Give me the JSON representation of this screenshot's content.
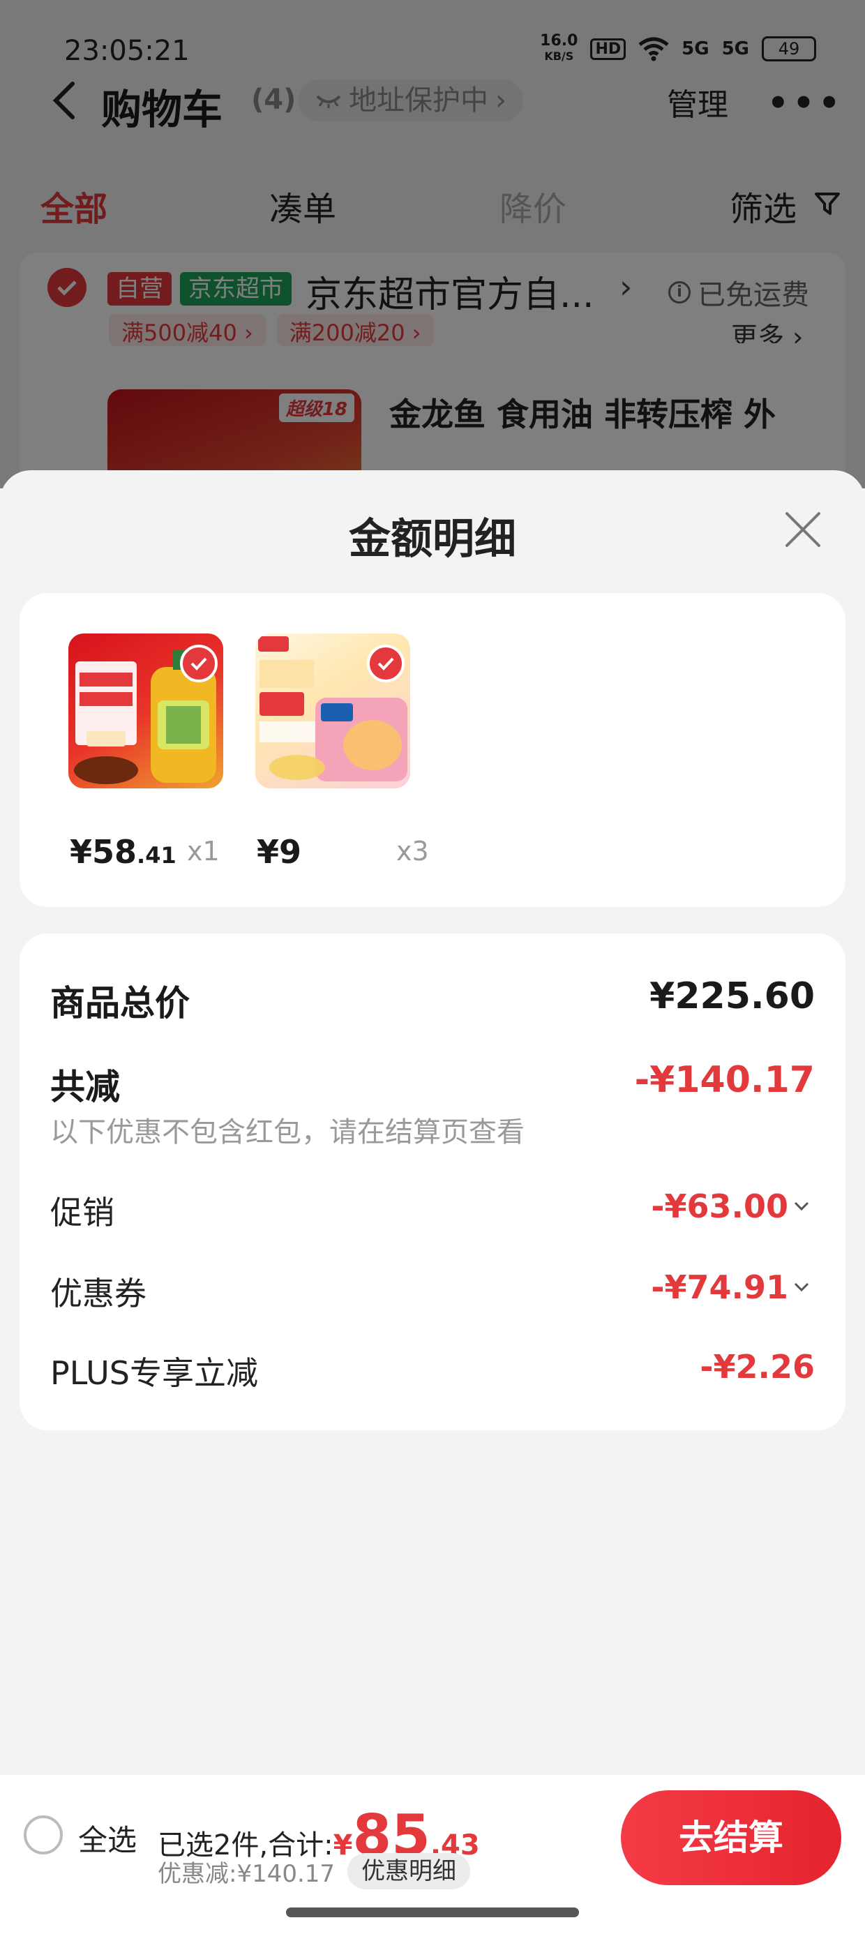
{
  "status_bar": {
    "time": "23:05:21",
    "net_speed_value": "16.0",
    "net_speed_unit": "KB/S",
    "hd": "HD",
    "sig1": "5G",
    "sig2": "5G",
    "battery": "49"
  },
  "nav": {
    "title": "购物车",
    "count": "(4)",
    "address_pill": "地址保护中",
    "manage": "管理",
    "more": "•••"
  },
  "tabs": {
    "all": "全部",
    "bundle": "凑单",
    "price_drop": "降价",
    "filter": "筛选"
  },
  "store": {
    "tag_self": "自营",
    "tag_jd": "京东超市",
    "name": "京东超市官方自...",
    "free_shipping": "已免运费",
    "promos": [
      "满500减40 ›",
      "满200减20 ›"
    ],
    "more": "更多 ›",
    "product_super_tag": "超级18",
    "product_name": "金龙鱼 食用油 非转压榨 外"
  },
  "sheet": {
    "title": "金额明细",
    "items": [
      {
        "price_int": "¥58",
        "price_dec": ".41",
        "qty": "x1"
      },
      {
        "price_int": "¥9",
        "price_dec": "",
        "qty": "x3"
      }
    ],
    "summary": {
      "total_label": "商品总价",
      "total_value": "¥225.60",
      "reduce_label": "共减",
      "reduce_value": "-¥140.17",
      "note": "以下优惠不包含红包，请在结算页查看",
      "promo_label": "促销",
      "promo_value": "-¥63.00",
      "coupon_label": "优惠券",
      "coupon_value": "-¥74.91",
      "plus_label": "PLUS专享立减",
      "plus_value": "-¥2.26"
    }
  },
  "action_bar": {
    "select_all": "全选",
    "selected_prefix": "已选2件,合计:",
    "total_yen": "¥",
    "total_int": "85",
    "total_dec": ".43",
    "discount": "优惠减:¥140.17",
    "detail_button": "优惠明细",
    "checkout": "去结算"
  },
  "colors": {
    "accent": "#e4393c",
    "jd_green": "#1fa35a"
  }
}
